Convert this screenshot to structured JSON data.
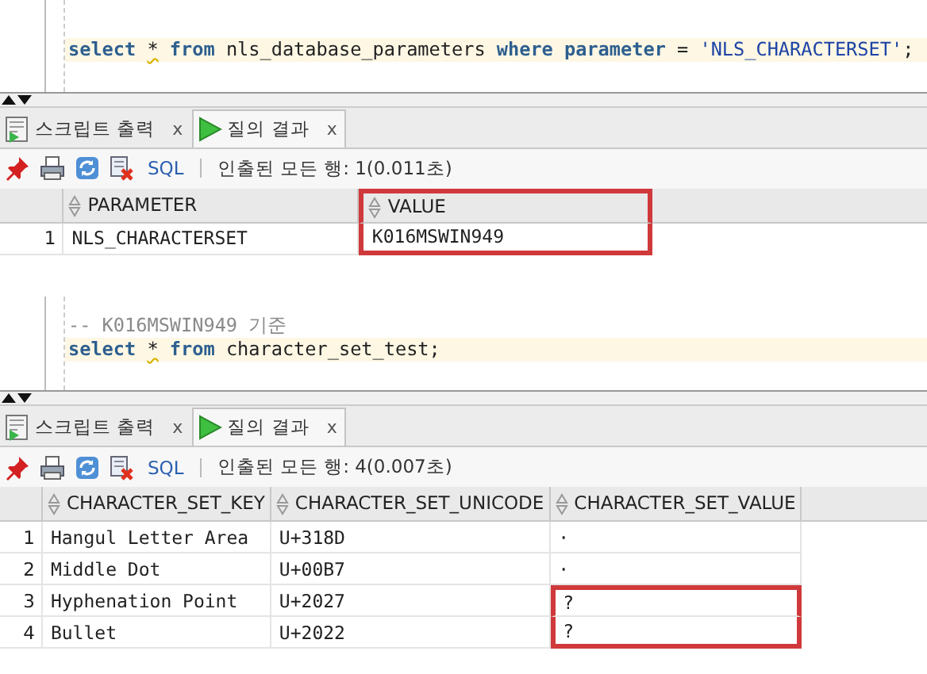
{
  "panels": [
    {
      "editor": {
        "lines": [
          {
            "current": true,
            "tokens": [
              {
                "kind": "keyword",
                "text": "select"
              },
              {
                "kind": "warning",
                "text": "*"
              },
              {
                "kind": "keyword",
                "text": "from"
              },
              {
                "kind": "plain",
                "text": "nls_database_parameters"
              },
              {
                "kind": "keyword",
                "text": "where"
              },
              {
                "kind": "keyword",
                "text": "parameter"
              },
              {
                "kind": "plain",
                "text": "="
              },
              {
                "kind": "string",
                "text": "'NLS_CHARACTERSET'"
              },
              {
                "kind": "punct",
                "text": ";"
              }
            ]
          }
        ]
      },
      "tabs": [
        {
          "label": "스크립트 출력",
          "selected": false,
          "close": "x"
        },
        {
          "label": "질의 결과",
          "selected": true,
          "close": "x"
        }
      ],
      "toolbar": {
        "sql_link": "SQL",
        "status": "인출된 모든 행: 1(0.011초)"
      },
      "grid": {
        "columns": [
          {
            "label": "PARAMETER",
            "highlighted": false
          },
          {
            "label": "VALUE",
            "highlighted": true
          }
        ],
        "rows": [
          {
            "number": "1",
            "cells": [
              {
                "text": "NLS_CHARACTERSET",
                "highlighted": false
              },
              {
                "text": "K016MSWIN949",
                "highlighted": true
              }
            ]
          }
        ]
      }
    },
    {
      "editor": {
        "lines": [
          {
            "current": false,
            "tokens": [
              {
                "kind": "comment",
                "text": "-- K016MSWIN949 기준"
              }
            ]
          },
          {
            "current": true,
            "tokens": [
              {
                "kind": "keyword",
                "text": "select"
              },
              {
                "kind": "warning",
                "text": "*"
              },
              {
                "kind": "keyword",
                "text": "from"
              },
              {
                "kind": "plain",
                "text": "character_set_test;"
              }
            ]
          }
        ]
      },
      "tabs": [
        {
          "label": "스크립트 출력",
          "selected": false,
          "close": "x"
        },
        {
          "label": "질의 결과",
          "selected": true,
          "close": "x"
        }
      ],
      "toolbar": {
        "sql_link": "SQL",
        "status": "인출된 모든 행: 4(0.007초)"
      },
      "grid": {
        "columns": [
          {
            "label": "CHARACTER_SET_KEY",
            "highlighted": false
          },
          {
            "label": "CHARACTER_SET_UNICODE",
            "highlighted": false
          },
          {
            "label": "CHARACTER_SET_VALUE",
            "highlighted": false
          }
        ],
        "rows": [
          {
            "number": "1",
            "cells": [
              {
                "text": "Hangul Letter Area",
                "highlighted": false
              },
              {
                "text": "U+318D",
                "highlighted": false
              },
              {
                "text": "·",
                "highlighted": false
              }
            ]
          },
          {
            "number": "2",
            "cells": [
              {
                "text": "Middle Dot",
                "highlighted": false
              },
              {
                "text": "U+00B7",
                "highlighted": false
              },
              {
                "text": "·",
                "highlighted": false
              }
            ]
          },
          {
            "number": "3",
            "cells": [
              {
                "text": "Hyphenation Point",
                "highlighted": false
              },
              {
                "text": "U+2027",
                "highlighted": false
              },
              {
                "text": "?",
                "highlighted": true
              }
            ]
          },
          {
            "number": "4",
            "cells": [
              {
                "text": "Bullet",
                "highlighted": false
              },
              {
                "text": "U+2022",
                "highlighted": false
              },
              {
                "text": "?",
                "highlighted": true
              }
            ]
          }
        ]
      }
    }
  ]
}
